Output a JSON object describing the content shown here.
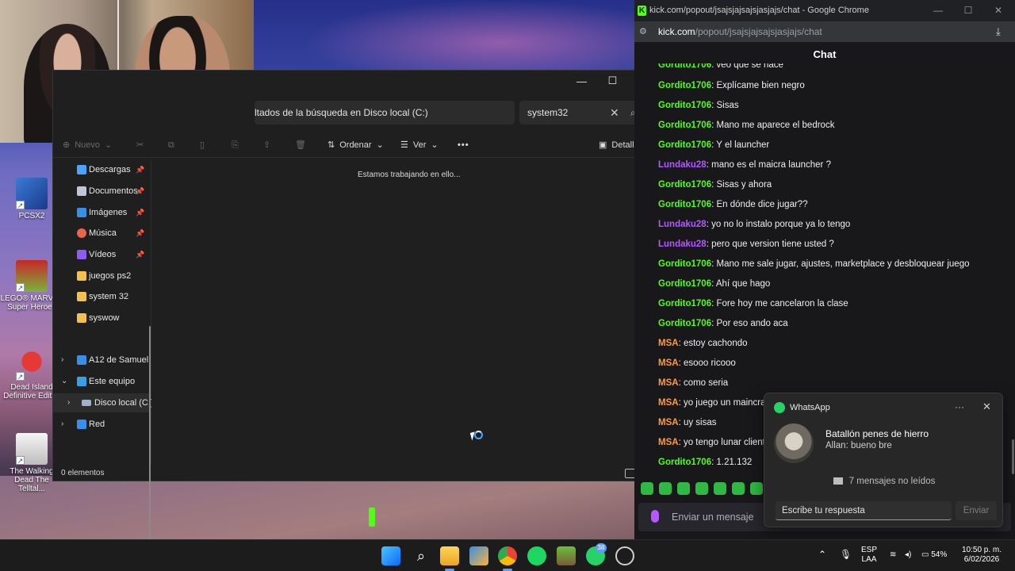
{
  "desktop": {
    "icons": [
      {
        "name": "desktop-icon-pcsx2",
        "label": "PCSX2"
      },
      {
        "name": "desktop-icon-lego-marvel",
        "label": "LEGO® MARVEL Super Heroes"
      },
      {
        "name": "desktop-icon-dead-island",
        "label": "Dead Island Definitive Editi..."
      },
      {
        "name": "desktop-icon-walking-dead",
        "label": "The Walking Dead The Telltal..."
      }
    ]
  },
  "explorer": {
    "breadcrumb": "ltados de la búsqueda en Disco local (C:)",
    "search_value": "system32",
    "toolbar": {
      "new": "Nuevo",
      "sort": "Ordenar",
      "view": "Ver",
      "more": "•••",
      "details": "Detalles"
    },
    "nav": [
      {
        "label": "Descargas",
        "pinned": true,
        "color": "#4aa3ff"
      },
      {
        "label": "Documentos",
        "pinned": true,
        "color": "#bfc7d5"
      },
      {
        "label": "Imágenes",
        "pinned": true,
        "color": "#3a8ee6"
      },
      {
        "label": "Música",
        "pinned": true,
        "color": "#e8664e"
      },
      {
        "label": "Vídeos",
        "pinned": true,
        "color": "#8d5cf0"
      },
      {
        "label": "juegos ps2",
        "pinned": false,
        "color": "#f2c14e"
      },
      {
        "label": "system 32",
        "pinned": false,
        "color": "#f2c14e"
      },
      {
        "label": "syswow",
        "pinned": false,
        "color": "#f2c14e"
      }
    ],
    "tree": [
      {
        "label": "A12 de Samuel",
        "chevron": "›",
        "color": "#3a8ee6"
      },
      {
        "label": "Este equipo",
        "chevron": "⌄",
        "color": "#3aa0e6"
      },
      {
        "label": "Disco local (C:)",
        "chevron": "›",
        "color": "#9fb3c8"
      },
      {
        "label": "Red",
        "chevron": "›",
        "color": "#3a8ee6"
      }
    ],
    "content_message": "Estamos trabajando en ello...",
    "status": "0 elementos"
  },
  "chrome": {
    "title": "kick.com/popout/jsajsjajsajsjasjajs/chat - Google Chrome",
    "url_host": "kick.com",
    "url_path": "/popout/jsajsjajsajsjasjajs/chat",
    "chat_title": "Chat",
    "input_placeholder": "Enviar un mensaje",
    "messages": [
      {
        "user": "Gordito1706",
        "color": "#53fc18",
        "text": "Explícame bien negro"
      },
      {
        "user": "Gordito1706",
        "color": "#53fc18",
        "text": "Sisas"
      },
      {
        "user": "Gordito1706",
        "color": "#53fc18",
        "text": "Mano me aparece el bedrock"
      },
      {
        "user": "Gordito1706",
        "color": "#53fc18",
        "text": "Y el launcher"
      },
      {
        "user": "Lundaku28",
        "color": "#b458ff",
        "text": "mano es el maicra launcher ?"
      },
      {
        "user": "Gordito1706",
        "color": "#53fc18",
        "text": "Sisas y ahora"
      },
      {
        "user": "Gordito1706",
        "color": "#53fc18",
        "text": "En dónde dice jugar??"
      },
      {
        "user": "Lundaku28",
        "color": "#b458ff",
        "text": "yo no lo instalo porque ya lo tengo"
      },
      {
        "user": "Lundaku28",
        "color": "#b458ff",
        "text": "pero que version tiene usted ?"
      },
      {
        "user": "Gordito1706",
        "color": "#53fc18",
        "text": "Mano me sale jugar, ajustes, marketplace y desbloquear juego"
      },
      {
        "user": "Gordito1706",
        "color": "#53fc18",
        "text": "Ahí que hago"
      },
      {
        "user": "Gordito1706",
        "color": "#53fc18",
        "text": "Fore hoy me cancelaron la clase"
      },
      {
        "user": "Gordito1706",
        "color": "#53fc18",
        "text": "Por eso ando aca"
      },
      {
        "user": "MSA",
        "color": "#ff9a3c",
        "text": "estoy cachondo"
      },
      {
        "user": "MSA",
        "color": "#ff9a3c",
        "text": "esooo ricooo"
      },
      {
        "user": "MSA",
        "color": "#ff9a3c",
        "text": "como seria"
      },
      {
        "user": "MSA",
        "color": "#ff9a3c",
        "text": "yo juego un maincra"
      },
      {
        "user": "MSA",
        "color": "#ff9a3c",
        "text": "uy sisas"
      },
      {
        "user": "MSA",
        "color": "#ff9a3c",
        "text": "yo tengo lunar client"
      },
      {
        "user": "Gordito1706",
        "color": "#53fc18",
        "text": "1.21.132"
      }
    ]
  },
  "whatsapp_toast": {
    "app": "WhatsApp",
    "group": "Batallón penes de hierro",
    "preview": "Allan: bueno bre",
    "unread": "7 mensajes no leídos",
    "reply_placeholder": "Escribe tu respuesta",
    "send": "Enviar"
  },
  "taskbar": {
    "whatsapp_badge": "38",
    "language": "ESP",
    "region": "LAA",
    "battery": "54%",
    "time": "10:50 p. m.",
    "date": "6/02/2026"
  }
}
